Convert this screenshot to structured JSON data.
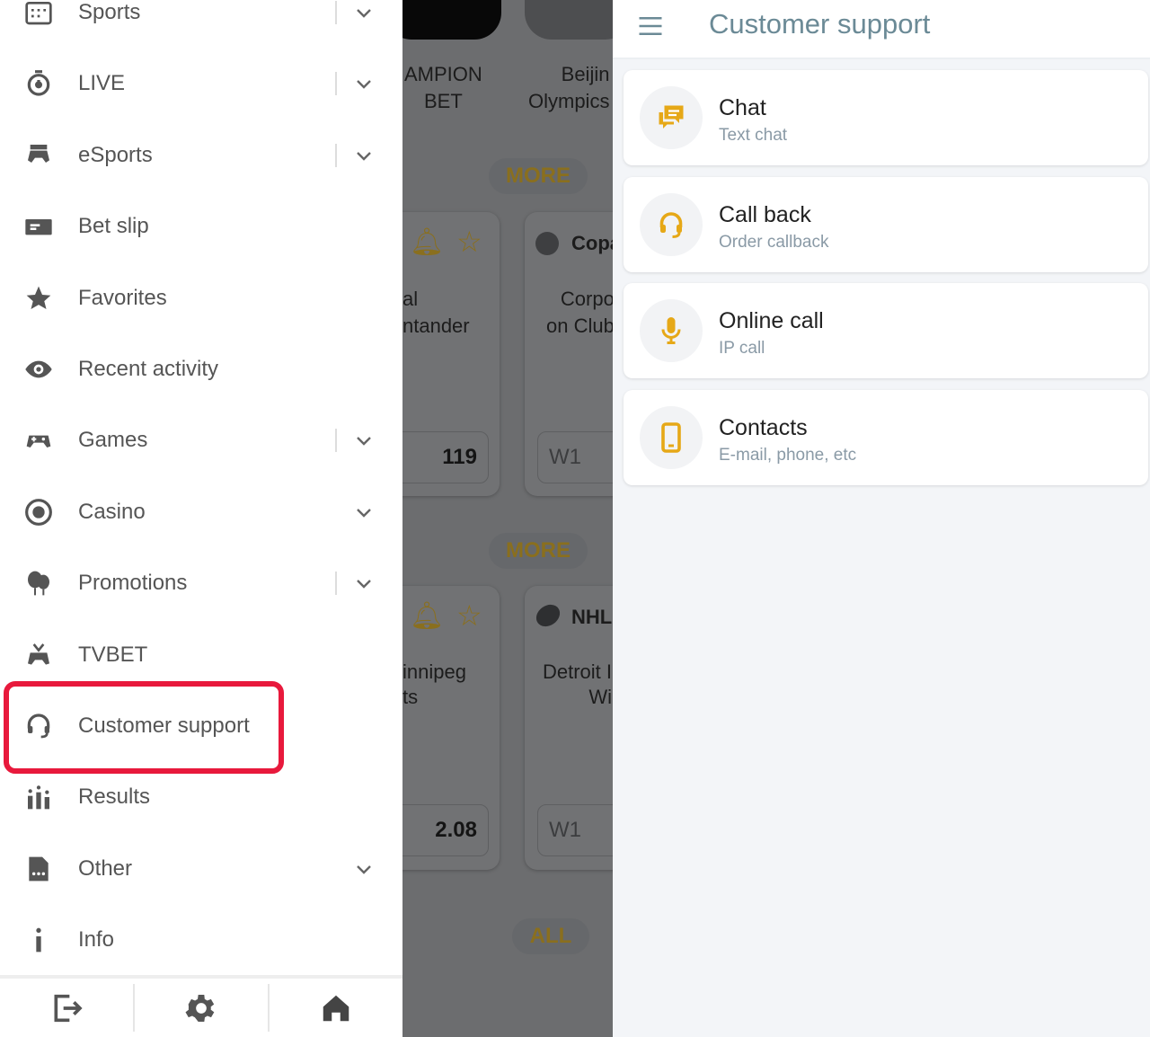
{
  "menu": {
    "items": [
      {
        "label": "Sports",
        "icon": "calendar-icon",
        "chevron": true,
        "divider": true
      },
      {
        "label": "LIVE",
        "icon": "stopwatch-icon",
        "chevron": true,
        "divider": true
      },
      {
        "label": "eSports",
        "icon": "gamepad-icon",
        "chevron": true,
        "divider": true
      },
      {
        "label": "Bet slip",
        "icon": "ticket-icon",
        "chevron": false,
        "divider": false
      },
      {
        "label": "Favorites",
        "icon": "star-icon",
        "chevron": false,
        "divider": false
      },
      {
        "label": "Recent activity",
        "icon": "eye-icon",
        "chevron": false,
        "divider": false
      },
      {
        "label": "Games",
        "icon": "joystick-icon",
        "chevron": true,
        "divider": true
      },
      {
        "label": "Casino",
        "icon": "chip-icon",
        "chevron": true,
        "divider": false
      },
      {
        "label": "Promotions",
        "icon": "balloons-icon",
        "chevron": true,
        "divider": true
      },
      {
        "label": "TVBET",
        "icon": "tv-gamepad-icon",
        "chevron": false,
        "divider": false
      },
      {
        "label": "Customer support",
        "icon": "headset-icon",
        "chevron": false,
        "divider": false
      },
      {
        "label": "Results",
        "icon": "bar-chart-icon",
        "chevron": false,
        "divider": false
      },
      {
        "label": "Other",
        "icon": "document-icon",
        "chevron": true,
        "divider": false
      },
      {
        "label": "Info",
        "icon": "info-icon",
        "chevron": false,
        "divider": false
      }
    ],
    "highlighted": "Customer support",
    "bottom": [
      "logout-icon",
      "settings-icon",
      "home-icon"
    ]
  },
  "background": {
    "banner1": "AMPION\nBET",
    "banner2": "Beijin\nOlympics",
    "more1": "MORE",
    "card1_teams": "al\nntander",
    "card1_odd": "119",
    "card2_league": "Copa",
    "card2_teams": "Corpo\non Club",
    "card2_odd": "W1",
    "more2": "MORE",
    "card3_teams": "innipeg\nts",
    "card3_odd": "2.08",
    "card4_league": "NHL",
    "card4_teams": "Detroit I\nWi",
    "card4_odd": "W1",
    "all": "ALL"
  },
  "support": {
    "title": "Customer support",
    "accent": "#e6a817",
    "options": [
      {
        "title": "Chat",
        "subtitle": "Text chat",
        "icon": "chat-icon"
      },
      {
        "title": "Call back",
        "subtitle": "Order callback",
        "icon": "headset-icon"
      },
      {
        "title": "Online call",
        "subtitle": "IP call",
        "icon": "microphone-icon"
      },
      {
        "title": "Contacts",
        "subtitle": "E-mail, phone, etc",
        "icon": "phone-icon"
      }
    ]
  }
}
